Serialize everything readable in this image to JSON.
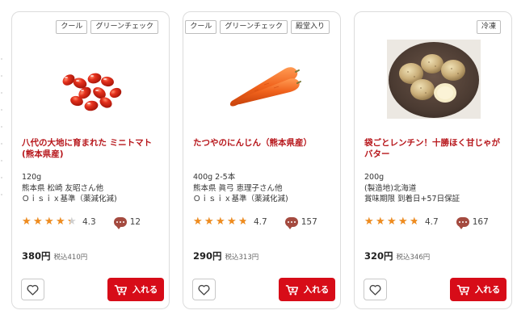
{
  "colors": {
    "title_red": "#b7161b",
    "star_orange": "#f08c1e",
    "cart_red": "#d70c18",
    "comment_icon": "#a44a3f"
  },
  "products": [
    {
      "badges": [
        "クール",
        "グリーンチェック"
      ],
      "image_icon": "cherry-tomatoes-image",
      "title": "八代の大地に育まれた ミニトマト(熊本県産)",
      "info": [
        "120g",
        "熊本県 松崎 友昭さん他",
        "Ｏｉｓｉｘ基準（薬減化減)"
      ],
      "rating": 4.3,
      "rating_text": "4.3",
      "comments": "12",
      "price": "380円",
      "tax_price": "税込410円",
      "cart_label": "入れる"
    },
    {
      "badges": [
        "クール",
        "グリーンチェック",
        "殿堂入り"
      ],
      "image_icon": "carrots-image",
      "title": "たつやのにんじん（熊本県産）",
      "info": [
        "400g 2-5本",
        "熊本県 眞弓 恵理子さん他",
        "Ｏｉｓｉｘ基準（薬減化減)"
      ],
      "rating": 4.7,
      "rating_text": "4.7",
      "comments": "157",
      "price": "290円",
      "tax_price": "税込313円",
      "cart_label": "入れる"
    },
    {
      "badges": [
        "冷凍"
      ],
      "image_icon": "potatoes-plate-image",
      "title": "袋ごとレンチン！十勝ほく甘じゃがバター",
      "info": [
        "200g",
        "(製造地)北海道",
        "賞味期限 到着日+57日保証"
      ],
      "rating": 4.7,
      "rating_text": "4.7",
      "comments": "167",
      "price": "320円",
      "tax_price": "税込346円",
      "cart_label": "入れる"
    }
  ]
}
